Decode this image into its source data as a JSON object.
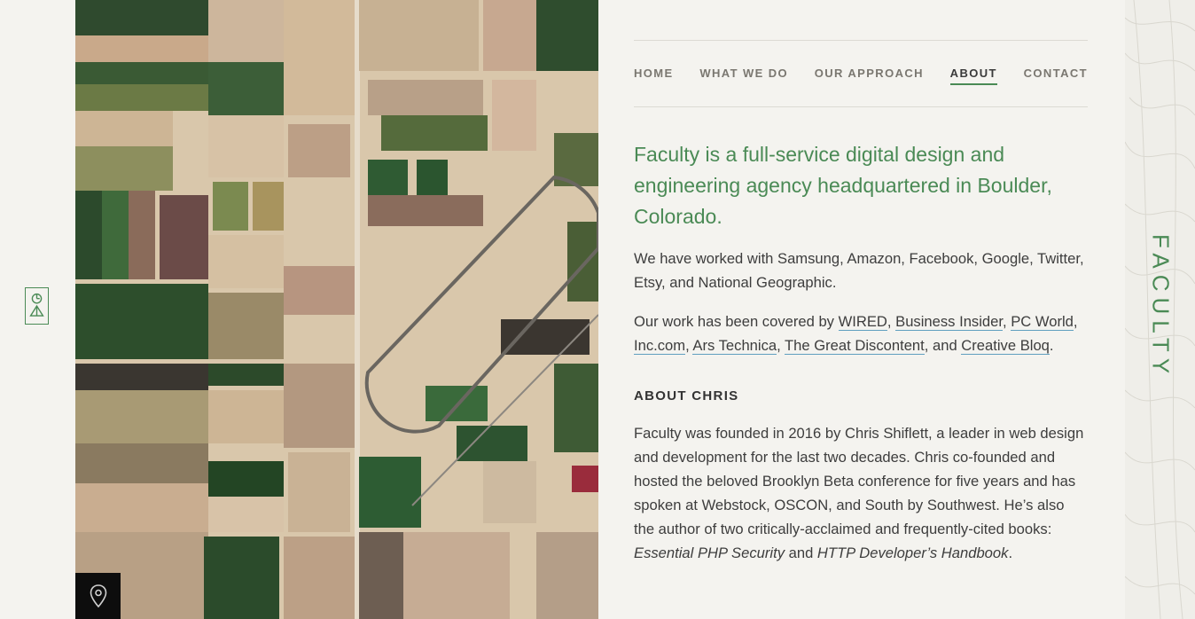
{
  "logo": {
    "icon": "faculty-mark-icon"
  },
  "nav": {
    "items": [
      {
        "label": "HOME",
        "active": false
      },
      {
        "label": "WHAT WE DO",
        "active": false
      },
      {
        "label": "OUR APPROACH",
        "active": false
      },
      {
        "label": "ABOUT",
        "active": true
      },
      {
        "label": "CONTACT",
        "active": false
      }
    ]
  },
  "intro": {
    "lede": "Faculty is a full-service digital design and engineering agency headquartered in Boulder, Colorado.",
    "clients": "We have worked with Samsung, Amazon, Facebook, Google, Twitter, Etsy, and National Geographic.",
    "press_prefix": "Our work has been covered by ",
    "press_links": [
      "WIRED",
      "Business Insider",
      "PC World",
      "Inc.com",
      "Ars Technica",
      "The Great Discontent",
      "Creative Bloq"
    ],
    "press_sep": ", ",
    "press_and": ", and ",
    "press_end": "."
  },
  "about": {
    "heading": "ABOUT CHRIS",
    "bio_text": "Faculty was founded in 2016 by Chris Shiflett, a leader in web design and development for the last two decades. Chris co-founded and hosted the beloved Brooklyn Beta conference for five years and has spoken at Webstock, OSCON, and South by Southwest. He’s also the author of two critically-acclaimed and frequently-cited books: ",
    "book1": "Essential PHP Security",
    "and": " and ",
    "book2": "HTTP Developer’s Handbook",
    "end": "."
  },
  "side": {
    "wordmark": "FACULTY"
  },
  "location_button": {
    "icon": "map-pin-icon"
  },
  "colors": {
    "accent": "#4a8a55",
    "link_underline": "#5f9fbf",
    "background": "#f4f3ef"
  }
}
